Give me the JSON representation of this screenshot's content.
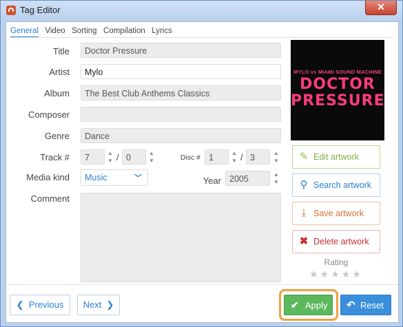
{
  "window": {
    "title": "Tag Editor",
    "close_glyph": "✕"
  },
  "tabs": [
    {
      "label": "General",
      "active": true
    },
    {
      "label": "Video"
    },
    {
      "label": "Sorting"
    },
    {
      "label": "Compilation"
    },
    {
      "label": "Lyrics"
    }
  ],
  "form": {
    "title": {
      "label": "Title",
      "value": "Doctor Pressure"
    },
    "artist": {
      "label": "Artist",
      "value": "Mylo"
    },
    "album": {
      "label": "Album",
      "value": "The Best Club Anthems Classics"
    },
    "composer": {
      "label": "Composer",
      "value": ""
    },
    "genre": {
      "label": "Genre",
      "value": "Dance"
    },
    "track": {
      "label": "Track #",
      "number": "7",
      "total": "0",
      "separator": "/"
    },
    "disc": {
      "label": "Disc #",
      "number": "1",
      "total": "3",
      "separator": "/"
    },
    "media_kind": {
      "label": "Media kind",
      "value": "Music"
    },
    "year": {
      "label": "Year",
      "value": "2005"
    },
    "comment": {
      "label": "Comment",
      "value": ""
    }
  },
  "artwork": {
    "small_text": "MYLO vs MIAMI SOUND MACHINE",
    "line1": "DOCTOR",
    "line2": "PRESSURE",
    "colors": {
      "text": "#ff3c7d",
      "background": "#0a0a0a"
    }
  },
  "artwork_actions": {
    "edit": {
      "label": "Edit artwork",
      "icon": "pencil-icon",
      "color": "#8cc152"
    },
    "search": {
      "label": "Search artwork",
      "icon": "search-icon",
      "color": "#2a7fd4"
    },
    "save": {
      "label": "Save artwork",
      "icon": "download-tray-icon",
      "color": "#d9712f"
    },
    "delete": {
      "label": "Delete artwork",
      "icon": "close-x-icon",
      "color": "#c9302c"
    }
  },
  "rating": {
    "label": "Rating",
    "stars": 0,
    "max": 5
  },
  "footer": {
    "previous": "Previous",
    "next": "Next",
    "apply": "Apply",
    "reset": "Reset"
  },
  "colors": {
    "accent": "#2a7fd4",
    "apply": "#5cb85c",
    "reset": "#3a8fdc",
    "highlight": "#f0a040"
  }
}
